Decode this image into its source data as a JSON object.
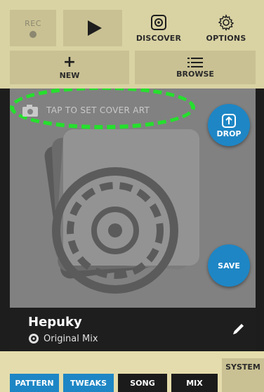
{
  "toolbar": {
    "rec_label": "REC",
    "discover_label": "DISCOVER",
    "options_label": "OPTIONS",
    "new_symbol": "+",
    "new_label": "NEW",
    "browse_label": "BROWSE"
  },
  "artwork": {
    "cover_hint": "TAP TO SET COVER ART",
    "drop_label": "DROP",
    "save_label": "SAVE"
  },
  "track": {
    "title": "Hepuky",
    "subtitle": "Original Mix"
  },
  "tabs": {
    "pattern": "PATTERN",
    "tweaks": "TWEAKS",
    "song": "SONG",
    "mix": "MIX",
    "system": "SYSTEM"
  },
  "colors": {
    "toolbar_bg": "#d9d2a3",
    "button_bg": "#c9c193",
    "accent_blue": "#1e86c5",
    "highlight_green": "#25e02d",
    "dark": "#1e1e1e"
  },
  "icons": [
    "record-dot-icon",
    "play-icon",
    "discover-icon",
    "gear-icon",
    "plus-icon",
    "list-icon",
    "camera-icon",
    "drop-icon",
    "vinyl-icon",
    "pencil-icon"
  ]
}
